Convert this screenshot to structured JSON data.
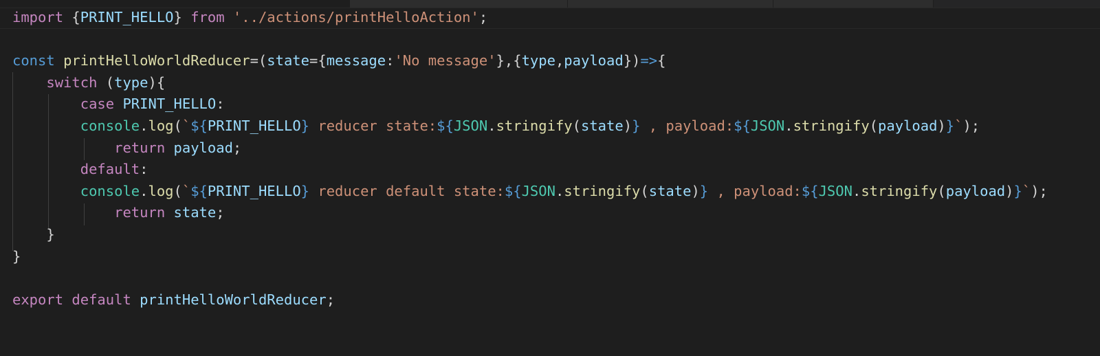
{
  "editor": {
    "language": "javascript",
    "theme_colors": {
      "background": "#1e1e1e",
      "keyword": "#c586c0",
      "storage": "#569cd6",
      "function": "#dcdcaa",
      "variable": "#9cdcfe",
      "constant": "#4fc1ff",
      "class": "#4ec9b0",
      "string": "#ce9178",
      "punctuation": "#d4d4d4"
    },
    "lines": [
      [
        {
          "t": "import",
          "c": "kw"
        },
        {
          "t": " {",
          "c": "pu"
        },
        {
          "t": "PRINT_HELLO",
          "c": "vr"
        },
        {
          "t": "} ",
          "c": "pu"
        },
        {
          "t": "from",
          "c": "kw"
        },
        {
          "t": " ",
          "c": "pu"
        },
        {
          "t": "'../actions/printHelloAction'",
          "c": "str"
        },
        {
          "t": ";",
          "c": "pu"
        }
      ],
      [],
      [
        {
          "t": "const",
          "c": "st"
        },
        {
          "t": " ",
          "c": "pu"
        },
        {
          "t": "printHelloWorldReducer",
          "c": "fn"
        },
        {
          "t": "=(",
          "c": "pu"
        },
        {
          "t": "state",
          "c": "vr"
        },
        {
          "t": "={",
          "c": "pu"
        },
        {
          "t": "message",
          "c": "vr"
        },
        {
          "t": ":",
          "c": "pu"
        },
        {
          "t": "'No message'",
          "c": "str"
        },
        {
          "t": "},{",
          "c": "pu"
        },
        {
          "t": "type",
          "c": "vr"
        },
        {
          "t": ",",
          "c": "pu"
        },
        {
          "t": "payload",
          "c": "vr"
        },
        {
          "t": "})",
          "c": "pu"
        },
        {
          "t": "=>",
          "c": "st"
        },
        {
          "t": "{",
          "c": "pu"
        }
      ],
      [
        {
          "t": "    ",
          "c": "pu"
        },
        {
          "t": "switch",
          "c": "kw"
        },
        {
          "t": " (",
          "c": "pu"
        },
        {
          "t": "type",
          "c": "vr"
        },
        {
          "t": "){",
          "c": "pu"
        }
      ],
      [
        {
          "t": "        ",
          "c": "pu"
        },
        {
          "t": "case",
          "c": "kw"
        },
        {
          "t": " ",
          "c": "pu"
        },
        {
          "t": "PRINT_HELLO",
          "c": "vr"
        },
        {
          "t": ":",
          "c": "pu"
        }
      ],
      [
        {
          "t": "        ",
          "c": "pu"
        },
        {
          "t": "console",
          "c": "cl"
        },
        {
          "t": ".",
          "c": "pu"
        },
        {
          "t": "log",
          "c": "fn"
        },
        {
          "t": "(",
          "c": "pu"
        },
        {
          "t": "`",
          "c": "str"
        },
        {
          "t": "${",
          "c": "tp"
        },
        {
          "t": "PRINT_HELLO",
          "c": "vr"
        },
        {
          "t": "}",
          "c": "tp"
        },
        {
          "t": " reducer state:",
          "c": "str"
        },
        {
          "t": "${",
          "c": "tp"
        },
        {
          "t": "JSON",
          "c": "cl"
        },
        {
          "t": ".",
          "c": "pu"
        },
        {
          "t": "stringify",
          "c": "fn"
        },
        {
          "t": "(",
          "c": "pu"
        },
        {
          "t": "state",
          "c": "vr"
        },
        {
          "t": ")",
          "c": "pu"
        },
        {
          "t": "}",
          "c": "tp"
        },
        {
          "t": " , payload:",
          "c": "str"
        },
        {
          "t": "${",
          "c": "tp"
        },
        {
          "t": "JSON",
          "c": "cl"
        },
        {
          "t": ".",
          "c": "pu"
        },
        {
          "t": "stringify",
          "c": "fn"
        },
        {
          "t": "(",
          "c": "pu"
        },
        {
          "t": "payload",
          "c": "vr"
        },
        {
          "t": ")",
          "c": "pu"
        },
        {
          "t": "}",
          "c": "tp"
        },
        {
          "t": "`",
          "c": "str"
        },
        {
          "t": ");",
          "c": "pu"
        }
      ],
      [
        {
          "t": "            ",
          "c": "pu"
        },
        {
          "t": "return",
          "c": "kw"
        },
        {
          "t": " ",
          "c": "pu"
        },
        {
          "t": "payload",
          "c": "vr"
        },
        {
          "t": ";",
          "c": "pu"
        }
      ],
      [
        {
          "t": "        ",
          "c": "pu"
        },
        {
          "t": "default",
          "c": "kw"
        },
        {
          "t": ":",
          "c": "pu"
        }
      ],
      [
        {
          "t": "        ",
          "c": "pu"
        },
        {
          "t": "console",
          "c": "cl"
        },
        {
          "t": ".",
          "c": "pu"
        },
        {
          "t": "log",
          "c": "fn"
        },
        {
          "t": "(",
          "c": "pu"
        },
        {
          "t": "`",
          "c": "str"
        },
        {
          "t": "${",
          "c": "tp"
        },
        {
          "t": "PRINT_HELLO",
          "c": "vr"
        },
        {
          "t": "}",
          "c": "tp"
        },
        {
          "t": " reducer default state:",
          "c": "str"
        },
        {
          "t": "${",
          "c": "tp"
        },
        {
          "t": "JSON",
          "c": "cl"
        },
        {
          "t": ".",
          "c": "pu"
        },
        {
          "t": "stringify",
          "c": "fn"
        },
        {
          "t": "(",
          "c": "pu"
        },
        {
          "t": "state",
          "c": "vr"
        },
        {
          "t": ")",
          "c": "pu"
        },
        {
          "t": "}",
          "c": "tp"
        },
        {
          "t": " , payload:",
          "c": "str"
        },
        {
          "t": "${",
          "c": "tp"
        },
        {
          "t": "JSON",
          "c": "cl"
        },
        {
          "t": ".",
          "c": "pu"
        },
        {
          "t": "stringify",
          "c": "fn"
        },
        {
          "t": "(",
          "c": "pu"
        },
        {
          "t": "payload",
          "c": "vr"
        },
        {
          "t": ")",
          "c": "pu"
        },
        {
          "t": "}",
          "c": "tp"
        },
        {
          "t": "`",
          "c": "str"
        },
        {
          "t": ");",
          "c": "pu"
        }
      ],
      [
        {
          "t": "            ",
          "c": "pu"
        },
        {
          "t": "return",
          "c": "kw"
        },
        {
          "t": " ",
          "c": "pu"
        },
        {
          "t": "state",
          "c": "vr"
        },
        {
          "t": ";",
          "c": "pu"
        }
      ],
      [
        {
          "t": "    }",
          "c": "pu"
        }
      ],
      [
        {
          "t": "}",
          "c": "pu"
        }
      ],
      [],
      [
        {
          "t": "export",
          "c": "kw"
        },
        {
          "t": " ",
          "c": "pu"
        },
        {
          "t": "default",
          "c": "kw"
        },
        {
          "t": " ",
          "c": "pu"
        },
        {
          "t": "printHelloWorldReducer",
          "c": "vr"
        },
        {
          "t": ";",
          "c": "pu"
        }
      ]
    ]
  }
}
